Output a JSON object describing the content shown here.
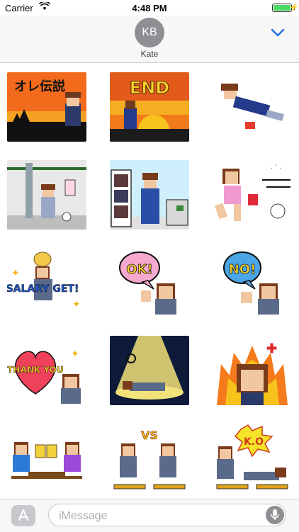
{
  "status_bar": {
    "carrier": "Carrier",
    "time": "4:48 PM"
  },
  "header": {
    "avatar_initials": "KB",
    "contact_name": "Kate"
  },
  "stickers": [
    {
      "label": "オレ伝説"
    },
    {
      "label": "END"
    },
    {
      "label": ""
    },
    {
      "label": ""
    },
    {
      "label": ""
    },
    {
      "label": ""
    },
    {
      "label": "SALARY GET!"
    },
    {
      "label": "OK!"
    },
    {
      "label": "NO!"
    },
    {
      "label": "THANK YOU"
    },
    {
      "label": ""
    },
    {
      "label": ""
    },
    {
      "label": ""
    },
    {
      "label": "VS"
    },
    {
      "label": "K.O"
    }
  ],
  "input": {
    "placeholder": "iMessage"
  },
  "colors": {
    "accent": "#2a6fdb",
    "battery": "#4cd964"
  }
}
